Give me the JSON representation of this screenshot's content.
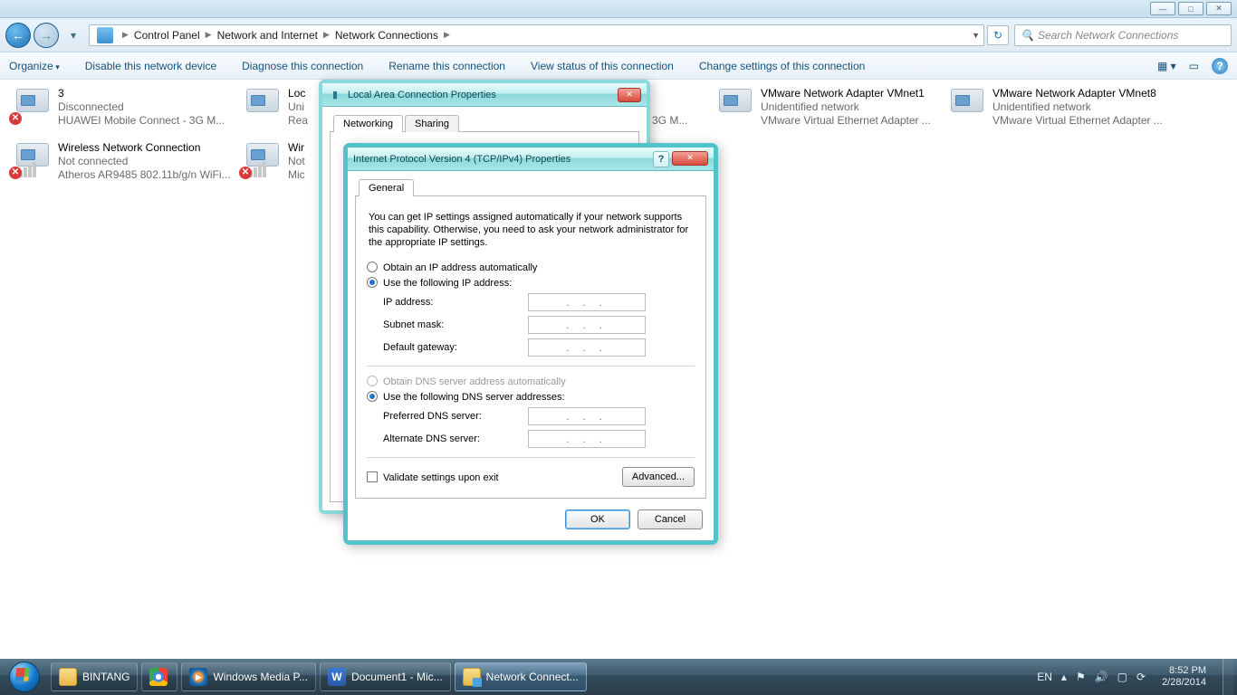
{
  "titlebar": {
    "min": "—",
    "max": "□",
    "close": "✕"
  },
  "nav": {
    "back": "←",
    "fwd": "→"
  },
  "breadcrumb": {
    "root_icon": "▸",
    "cp": "Control Panel",
    "ni": "Network and Internet",
    "nc": "Network Connections"
  },
  "search": {
    "placeholder": "Search Network Connections"
  },
  "cmd": {
    "organize": "Organize",
    "disable": "Disable this network device",
    "diagnose": "Diagnose this connection",
    "rename": "Rename this connection",
    "status": "View status of this connection",
    "change": "Change settings of this connection"
  },
  "connections": [
    {
      "t1": "3",
      "t2": "Disconnected",
      "t3": "HUAWEI Mobile Connect - 3G M...",
      "x": true,
      "bars": "gray"
    },
    {
      "t1": "Loc",
      "t2": "Uni",
      "t3": "Rea",
      "bars": "none"
    },
    {
      "t1": "",
      "t2": "",
      "t3": "3G M...",
      "bars": "none"
    },
    {
      "t1": "VMware Network Adapter VMnet1",
      "t2": "Unidentified network",
      "t3": "VMware Virtual Ethernet Adapter ...",
      "bars": "none"
    },
    {
      "t1": "VMware Network Adapter VMnet8",
      "t2": "Unidentified network",
      "t3": "VMware Virtual Ethernet Adapter ...",
      "bars": "none"
    },
    {
      "t1": "Wireless Network Connection",
      "t2": "Not connected",
      "t3": "Atheros AR9485 802.11b/g/n WiFi...",
      "x": true,
      "bars": "gray"
    },
    {
      "t1": "Wir",
      "t2": "Not",
      "t3": "Mic",
      "x": true,
      "bars": "gray"
    }
  ],
  "dlg_lac": {
    "title": "Local Area Connection Properties",
    "tab_net": "Networking",
    "tab_share": "Sharing"
  },
  "dlg_ip": {
    "title": "Internet Protocol Version 4 (TCP/IPv4) Properties",
    "tab_general": "General",
    "desc": "You can get IP settings assigned automatically if your network supports this capability. Otherwise, you need to ask your network administrator for the appropriate IP settings.",
    "r_auto_ip": "Obtain an IP address automatically",
    "r_use_ip": "Use the following IP address:",
    "l_ip": "IP address:",
    "l_mask": "Subnet mask:",
    "l_gw": "Default gateway:",
    "r_auto_dns": "Obtain DNS server address automatically",
    "r_use_dns": "Use the following DNS server addresses:",
    "l_dns1": "Preferred DNS server:",
    "l_dns2": "Alternate DNS server:",
    "chk_validate": "Validate settings upon exit",
    "btn_adv": "Advanced...",
    "btn_ok": "OK",
    "btn_cancel": "Cancel",
    "dots": ".   .   ."
  },
  "taskbar": {
    "folder": "BINTANG",
    "wmp": "Windows Media P...",
    "word": "Document1 - Mic...",
    "explorer": "Network Connect...",
    "lang": "EN",
    "time": "8:52 PM",
    "date": "2/28/2014"
  }
}
